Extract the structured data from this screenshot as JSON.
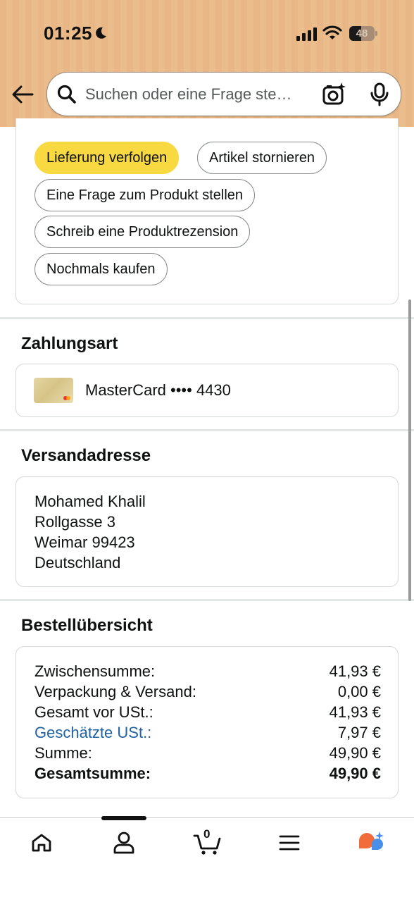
{
  "status_bar": {
    "time": "01:25",
    "battery_level": "48",
    "battery_fraction": 0.48
  },
  "search": {
    "placeholder": "Suchen oder eine Frage ste…"
  },
  "actions": {
    "track": "Lieferung verfolgen",
    "cancel": "Artikel stornieren",
    "ask_question": "Eine Frage zum Produkt stellen",
    "write_review": "Schreib eine Produktrezension",
    "buy_again": "Nochmals kaufen"
  },
  "payment": {
    "title": "Zahlungsart",
    "card_label": "MasterCard •••• 4430"
  },
  "shipping": {
    "title": "Versandadresse",
    "lines": [
      "Mohamed Khalil",
      "Rollgasse 3",
      "Weimar 99423",
      "Deutschland"
    ]
  },
  "summary": {
    "title": "Bestellübersicht",
    "rows": [
      {
        "label": "Zwischensumme:",
        "value": "41,93 €"
      },
      {
        "label": "Verpackung & Versand:",
        "value": "0,00 €"
      },
      {
        "label": "Gesamt vor USt.:",
        "value": "41,93 €"
      },
      {
        "label": "Geschätzte USt.:",
        "value": "7,97 €"
      },
      {
        "label": "Summe:",
        "value": "49,90 €"
      },
      {
        "label": "Gesamtsumme:",
        "value": "49,90 €"
      }
    ]
  },
  "nav": {
    "cart_count": "0",
    "items": [
      "home-icon",
      "account-icon",
      "cart-icon",
      "menu-icon",
      "rufus-icon"
    ]
  },
  "colors": {
    "header_bg": "#e8b785",
    "primary_button": "#f8d941",
    "link": "#2162a1"
  }
}
